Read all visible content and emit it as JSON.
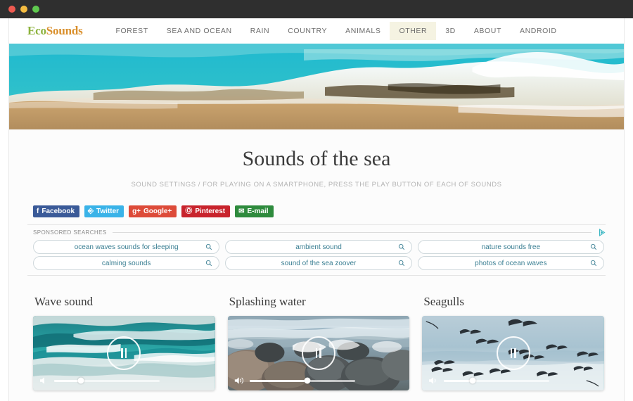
{
  "window": {
    "controls": [
      "close",
      "minimize",
      "maximize"
    ]
  },
  "header": {
    "logo_part1": "Eco",
    "logo_part2": "Sounds",
    "logo_color_1": "#8cb23c",
    "logo_color_2": "#d98f2b",
    "nav": [
      {
        "label": "FOREST",
        "active": false
      },
      {
        "label": "SEA AND OCEAN",
        "active": false
      },
      {
        "label": "RAIN",
        "active": false
      },
      {
        "label": "COUNTRY",
        "active": false
      },
      {
        "label": "ANIMALS",
        "active": false
      },
      {
        "label": "OTHER",
        "active": true
      },
      {
        "label": "3D",
        "active": false
      },
      {
        "label": "ABOUT",
        "active": false
      },
      {
        "label": "ANDROID",
        "active": false
      }
    ],
    "active_nav_bg": "#f5f3e2"
  },
  "hero": {
    "alt": "ocean wave breaking on sandy beach",
    "colors": {
      "sea": "#29b6c7",
      "sea_deep": "#1aa3b8",
      "foam": "#f4f1e6",
      "sand": "#c9a470",
      "rock": "#6b5434"
    }
  },
  "main": {
    "title": "Sounds of the sea",
    "subtitle": "SOUND SETTINGS / FOR PLAYING ON A SMARTPHONE, PRESS THE PLAY BUTTON OF EACH OF SOUNDS"
  },
  "social": [
    {
      "label": "Facebook",
      "icon": "facebook-icon",
      "glyph": "f",
      "color": "#3a5a98",
      "key": "facebook"
    },
    {
      "label": "Twitter",
      "icon": "twitter-icon",
      "glyph": "ᵗ",
      "color": "#3ab3e8",
      "key": "twitter"
    },
    {
      "label": "Google+",
      "icon": "googleplus-icon",
      "glyph": "g+",
      "color": "#dd4b39",
      "key": "googleplus"
    },
    {
      "label": "Pinterest",
      "icon": "pinterest-icon",
      "glyph": "p",
      "color": "#c8232c",
      "key": "pinterest"
    },
    {
      "label": "E-mail",
      "icon": "email-icon",
      "glyph": "✉",
      "color": "#2e8b3d",
      "key": "email"
    }
  ],
  "ads": {
    "header_label": "SPONSORED SEARCHES",
    "adchoices_icon": "adchoices-triangle-icon",
    "adchoices_color": "#3fb8c4",
    "link_color": "#3b7f93",
    "items": [
      "ocean waves sounds for sleeping",
      "ambient sound",
      "nature sounds free",
      "calming sounds",
      "sound of the sea zoover",
      "photos of ocean waves"
    ],
    "search_icon": "magnifier-icon"
  },
  "players": [
    {
      "title": "Wave sound",
      "art": "waves",
      "play_state": "playing",
      "play_icon": "pause-icon",
      "volume_icon": "volume-low-icon",
      "volume_percent": 25
    },
    {
      "title": "Splashing water",
      "art": "rocks",
      "play_state": "playing",
      "play_icon": "pause-icon",
      "volume_icon": "volume-high-icon",
      "volume_percent": 55
    },
    {
      "title": "Seagulls",
      "art": "seagulls",
      "play_state": "playing",
      "play_icon": "pause-icon",
      "volume_icon": "volume-medium-icon",
      "volume_percent": 27
    }
  ]
}
